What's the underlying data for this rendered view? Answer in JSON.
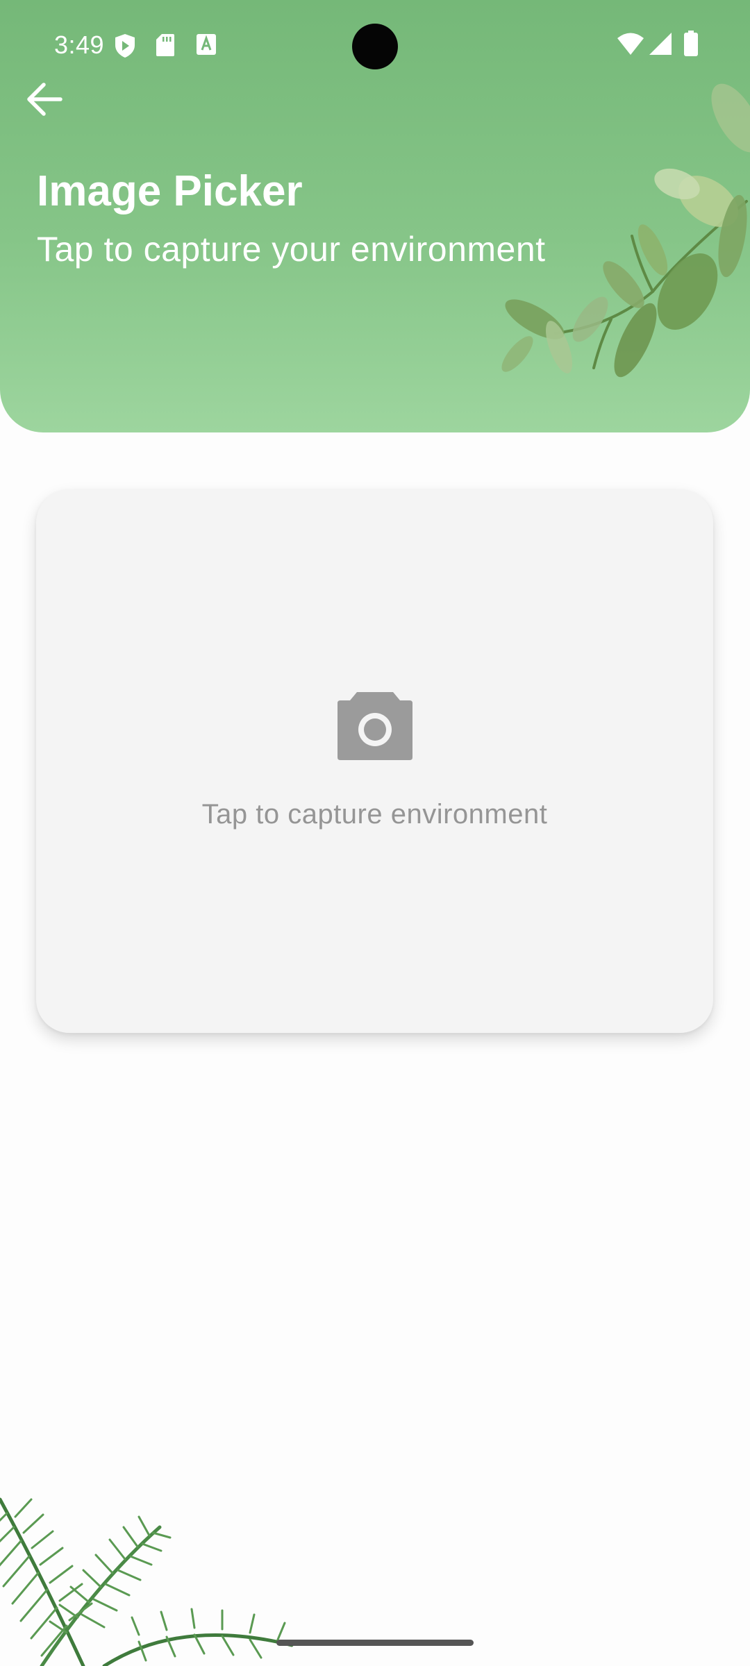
{
  "status_bar": {
    "time": "3:49",
    "left_icons": [
      "shield-play-icon",
      "sd-card-icon",
      "text-a-icon"
    ],
    "right_icons": [
      "wifi-icon",
      "signal-icon",
      "battery-icon"
    ]
  },
  "header": {
    "back_icon": "arrow-back-icon",
    "title": "Image Picker",
    "subtitle": "Tap to capture your environment",
    "colors": {
      "gradient_top": "#75b878",
      "gradient_bottom": "#9dd59e"
    }
  },
  "capture_card": {
    "icon": "camera-icon",
    "label": "Tap to capture environment"
  },
  "decorations": [
    "eucalyptus-leaves-illustration",
    "palm-leaves-illustration"
  ]
}
